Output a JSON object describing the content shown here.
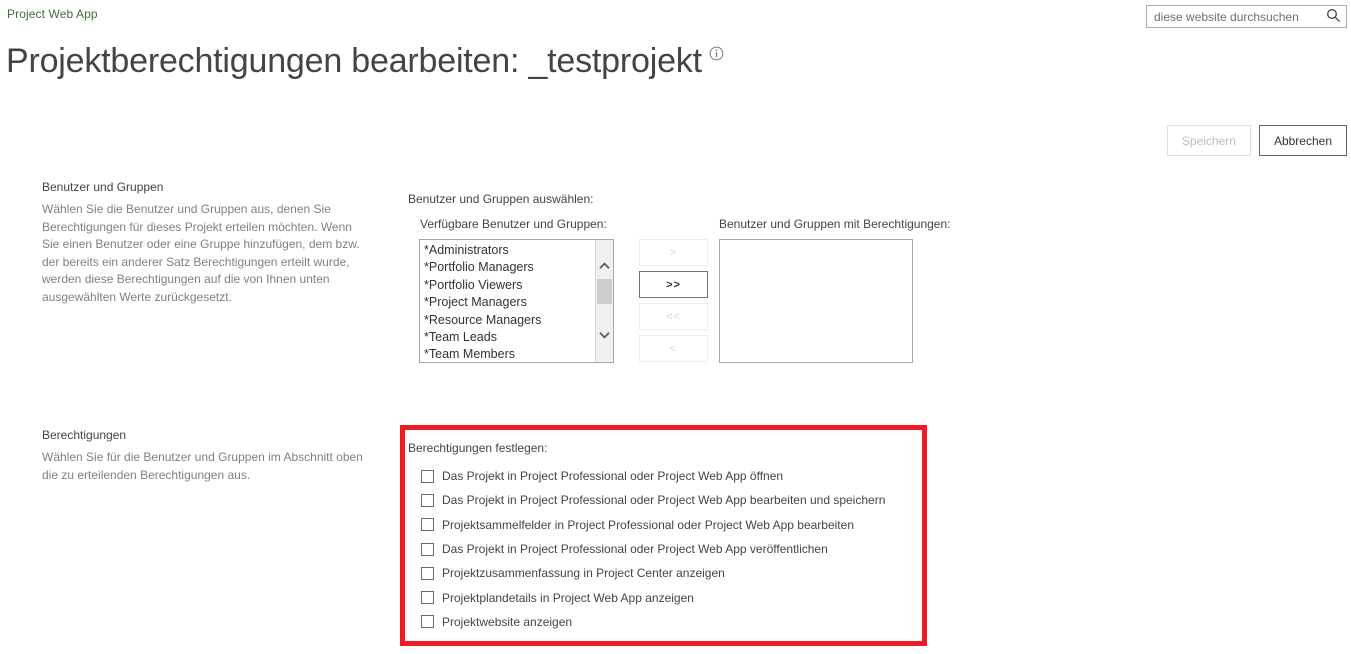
{
  "header": {
    "suite_link": "Project Web App",
    "page_title": "Projektberechtigungen bearbeiten: _testprojekt",
    "info_icon": "info-circle-icon"
  },
  "search": {
    "placeholder": "diese website durchsuchen",
    "value": "",
    "icon": "search-icon"
  },
  "actions": {
    "save_label": "Speichern",
    "save_enabled": false,
    "cancel_label": "Abbrechen",
    "cancel_enabled": true
  },
  "users_section": {
    "label": "Benutzer und Gruppen",
    "description": "Wählen Sie die Benutzer und Gruppen aus, denen Sie Berechtigungen für dieses Projekt erteilen möchten. Wenn Sie einen Benutzer oder eine Gruppe hinzufügen, dem bzw. der bereits ein anderer Satz Berechtigungen erteilt wurde, werden diese Berechtigungen auf die von Ihnen unten ausgewählten Werte zurückgesetzt.",
    "picker_label": "Benutzer und Gruppen auswählen:",
    "available_label": "Verfügbare Benutzer und Gruppen:",
    "selected_label": "Benutzer und Gruppen mit Berechtigungen:",
    "available_items": [
      "*Administrators",
      "*Portfolio Managers",
      "*Portfolio Viewers",
      "*Project Managers",
      "*Resource Managers",
      "*Team Leads",
      "*Team Members"
    ],
    "selected_items": [],
    "transfer_buttons": [
      {
        "label": ">",
        "name": "move-right-single-button",
        "enabled": false
      },
      {
        "label": ">>",
        "name": "move-right-all-button",
        "enabled": true
      },
      {
        "label": "<<",
        "name": "move-left-all-button",
        "enabled": false
      },
      {
        "label": "<",
        "name": "move-left-single-button",
        "enabled": false
      }
    ],
    "scrollbar": {
      "up_icon": "chevron-up-icon",
      "down_icon": "chevron-down-icon"
    }
  },
  "permissions_section": {
    "label": "Berechtigungen",
    "description": "Wählen Sie für die Benutzer und Gruppen im Abschnitt oben die zu erteilenden Berechtigungen aus.",
    "set_label": "Berechtigungen festlegen:",
    "highlight_color": "#ed1c24",
    "items": [
      {
        "label": "Das Projekt in Project Professional oder Project Web App öffnen",
        "checked": false
      },
      {
        "label": "Das Projekt in Project Professional oder Project Web App bearbeiten und speichern",
        "checked": false
      },
      {
        "label": "Projektsammelfelder in Project Professional oder Project Web App bearbeiten",
        "checked": false
      },
      {
        "label": "Das Projekt in Project Professional oder Project Web App veröffentlichen",
        "checked": false
      },
      {
        "label": "Projektzusammenfassung in Project Center anzeigen",
        "checked": false
      },
      {
        "label": "Projektplandetails in Project Web App anzeigen",
        "checked": false
      },
      {
        "label": "Projektwebsite anzeigen",
        "checked": false
      }
    ]
  },
  "colors": {
    "link_green": "#3c6e3c",
    "text_primary": "#444444",
    "text_muted": "#808080",
    "highlight_red": "#ed1c24"
  }
}
